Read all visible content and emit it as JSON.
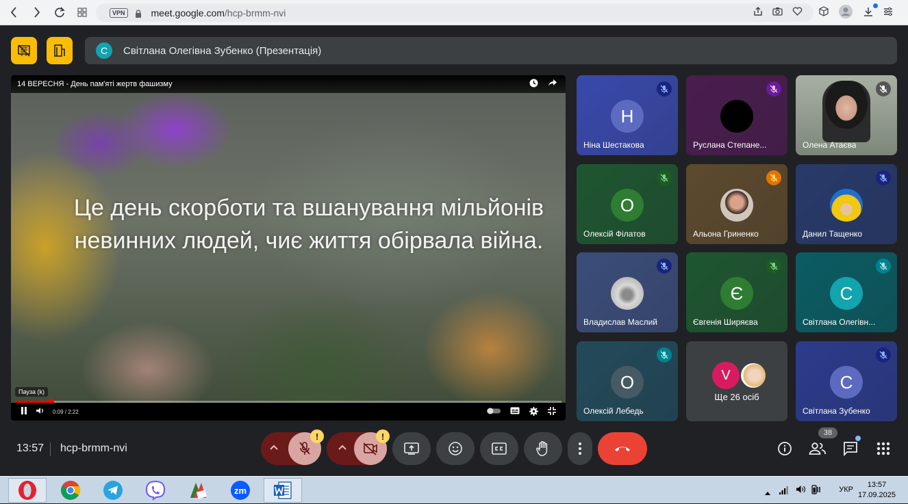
{
  "browser": {
    "vpn_label": "VPN",
    "url_host": "meet.google.com",
    "url_path": "/hcp-brmm-nvi"
  },
  "header": {
    "presenter_initial": "С",
    "presenter_title": "Світлана Олегівна Зубенко (Презентація)"
  },
  "video": {
    "title": "14 ВЕРЕСНЯ - День пам'яті жертв фашизму",
    "caption": "Це день скорботи та вшанування мільйонів невинних людей, чиє життя обірвала війна.",
    "pause_tooltip": "Пауза (k)",
    "time": "0:09 / 2:22",
    "progress": 0.065
  },
  "participants": [
    {
      "name": "Ніна Шестакова",
      "initial": "Н",
      "bg": "#3949ab",
      "avatar": "#5c6bc0"
    },
    {
      "name": "Руслана Степане...",
      "initial": "",
      "bg": "#4a1d4f",
      "avatar": "#000000"
    },
    {
      "name": "Олена Атаєва",
      "initial": "",
      "bg": "#8d9a8a",
      "avatar": ""
    },
    {
      "name": "Олексій Філатов",
      "initial": "О",
      "bg": "#1e5631",
      "avatar": "#2e7d32"
    },
    {
      "name": "Альона Гриненко",
      "initial": "",
      "bg": "#5d4a2e",
      "avatar": "#c9c2b8"
    },
    {
      "name": "Данил Тащенко",
      "initial": "",
      "bg": "#283a6b",
      "avatar": "#f2c811"
    },
    {
      "name": "Владислав Маслий",
      "initial": "",
      "bg": "#3b4d7a",
      "avatar": "#c6c6c6"
    },
    {
      "name": "Євгенія Ширяєва",
      "initial": "Є",
      "bg": "#1e5631",
      "avatar": "#2e7d32"
    },
    {
      "name": "Світлана Олегівн...",
      "initial": "С",
      "bg": "#0b5c63",
      "avatar": "#12a4af"
    },
    {
      "name": "Олексій Лебедь",
      "initial": "О",
      "bg": "#234a5a",
      "avatar": "#455a64"
    },
    {
      "name": "Ще 26 осіб",
      "initial": "V",
      "bg": "#3c4043",
      "avatar": "#d81b60"
    },
    {
      "name": "Світлана Зубенко",
      "initial": "С",
      "bg": "#2c3b8c",
      "avatar": "#5c6bc0"
    }
  ],
  "bottom": {
    "clock": "13:57",
    "meeting_code": "hcp-brmm-nvi",
    "people_count": "38",
    "warn": "!"
  },
  "taskbar": {
    "zoom_label": "zm",
    "language": "УКР",
    "time": "13:57",
    "date": "17.09.2025"
  },
  "colors": {
    "yellow": "#fbbc04",
    "end_call": "#ea4335",
    "mic_off_btn": "#d9a5a2"
  }
}
